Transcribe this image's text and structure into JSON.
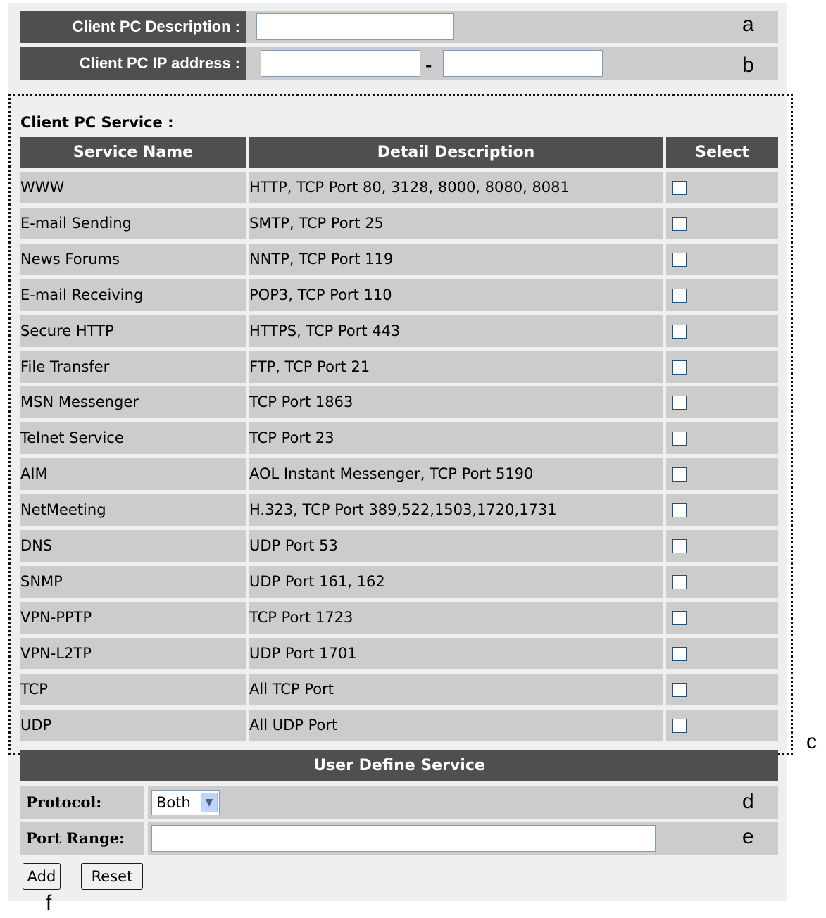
{
  "client_pc": {
    "description_label": "Client PC Description :",
    "description_value": "",
    "ip_label": "Client PC IP address :",
    "ip_start_value": "",
    "ip_separator": "-",
    "ip_end_value": ""
  },
  "service": {
    "section_title": "Client PC Service :",
    "columns": [
      "Service Name",
      "Detail Description",
      "Select"
    ],
    "rows": [
      {
        "name": "WWW",
        "detail": "HTTP, TCP Port 80, 3128, 8000, 8080, 8081"
      },
      {
        "name": "E-mail Sending",
        "detail": "SMTP, TCP Port 25"
      },
      {
        "name": "News Forums",
        "detail": "NNTP, TCP Port 119"
      },
      {
        "name": "E-mail Receiving",
        "detail": "POP3, TCP Port 110"
      },
      {
        "name": "Secure HTTP",
        "detail": "HTTPS, TCP Port 443"
      },
      {
        "name": "File Transfer",
        "detail": "FTP, TCP Port 21"
      },
      {
        "name": "MSN Messenger",
        "detail": "TCP Port 1863"
      },
      {
        "name": "Telnet Service",
        "detail": "TCP Port 23"
      },
      {
        "name": "AIM",
        "detail": "AOL Instant Messenger, TCP Port 5190"
      },
      {
        "name": "NetMeeting",
        "detail": "H.323, TCP Port 389,522,1503,1720,1731"
      },
      {
        "name": "DNS",
        "detail": "UDP Port 53"
      },
      {
        "name": "SNMP",
        "detail": "UDP Port 161, 162"
      },
      {
        "name": "VPN-PPTP",
        "detail": "TCP Port 1723"
      },
      {
        "name": "VPN-L2TP",
        "detail": "UDP Port 1701"
      },
      {
        "name": "TCP",
        "detail": "All TCP Port"
      },
      {
        "name": "UDP",
        "detail": "All UDP Port"
      }
    ]
  },
  "user_define": {
    "title": "User Define Service",
    "protocol_label": "Protocol:",
    "protocol_value": "Both",
    "port_range_label": "Port Range:",
    "port_range_value": ""
  },
  "buttons": {
    "add": "Add",
    "reset": "Reset"
  },
  "annotations": {
    "a": "a",
    "b": "b",
    "c": "c",
    "d": "d",
    "e": "e",
    "f": "f"
  },
  "colors": {
    "panel_bg": "#efefef",
    "row_bg": "#cccccc",
    "header_bg": "#4f4f4f",
    "header_text": "#ffffff"
  },
  "icons": {
    "select_arrow": "chevron-down-icon",
    "checkbox": "checkbox-icon"
  }
}
